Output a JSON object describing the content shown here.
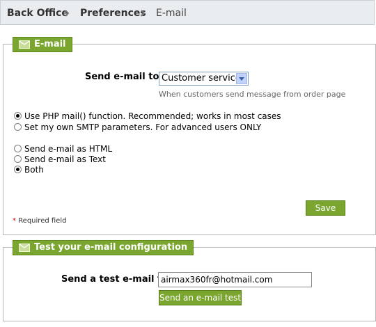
{
  "breadcrumb": {
    "items": [
      "Back Office",
      "Preferences",
      "E-mail"
    ]
  },
  "email_section": {
    "legend": "E-mail",
    "send_to_label": "Send e-mail to:",
    "send_to_value": "Customer service",
    "send_to_hint": "When customers send message from order page",
    "mail_method_options": [
      {
        "label": "Use PHP mail() function. Recommended; works in most cases",
        "checked": true
      },
      {
        "label": "Set my own SMTP parameters. For advanced users ONLY",
        "checked": false
      }
    ],
    "format_options": [
      {
        "label": "Send e-mail as HTML",
        "checked": false
      },
      {
        "label": "Send e-mail as Text",
        "checked": false
      },
      {
        "label": "Both",
        "checked": true
      }
    ],
    "save_label": "Save",
    "required_star": "*",
    "required_text": "Required field"
  },
  "test_section": {
    "legend": "Test your e-mail configuration",
    "label": "Send a test e-mail to",
    "email_value": "airmax360fr@hotmail.com",
    "button_label": "Send an e-mail test"
  },
  "colors": {
    "accent_green": "#7aa62f",
    "breadcrumb_bg": "#e9edf0"
  }
}
